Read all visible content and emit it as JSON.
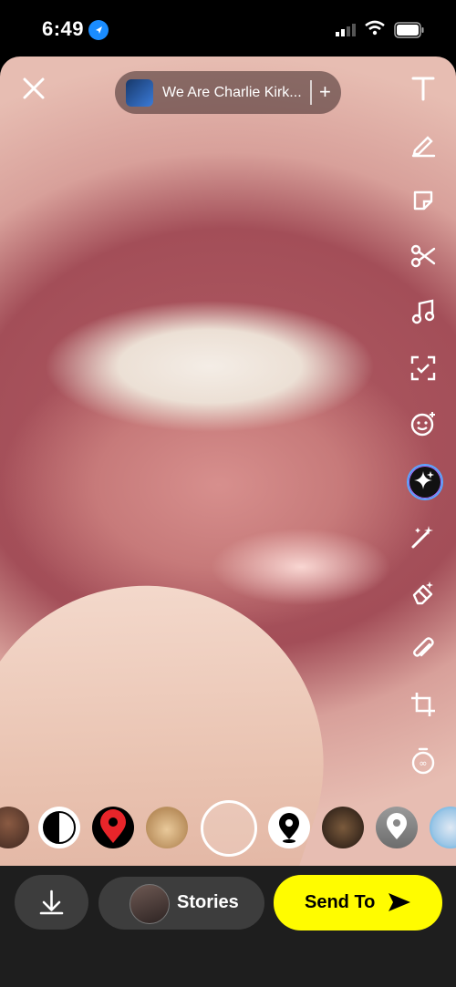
{
  "status_bar": {
    "time": "6:49"
  },
  "header": {
    "close_icon": "close-icon",
    "music": {
      "title": "We Are Charlie Kirk...",
      "add": "+"
    }
  },
  "tools": [
    "text-icon",
    "pencil-icon",
    "sticker-icon",
    "scissors-icon",
    "music-icon",
    "scan-icon",
    "emoji-icon",
    "ai-sparkle-icon",
    "magic-wand-icon",
    "eraser-icon",
    "paperclip-icon",
    "crop-icon",
    "timer-icon"
  ],
  "lenses": [
    "lens-person",
    "lens-halfmoon",
    "lens-map-pin",
    "lens-hamster",
    "lens-capture",
    "lens-location",
    "lens-monkey",
    "lens-gray-pin",
    "lens-blue"
  ],
  "bottom": {
    "save_icon": "download-icon",
    "stories_label": "Stories",
    "send_label": "Send To"
  },
  "colors": {
    "send_button": "#fffc00",
    "accent_blue": "#1a8cff"
  }
}
